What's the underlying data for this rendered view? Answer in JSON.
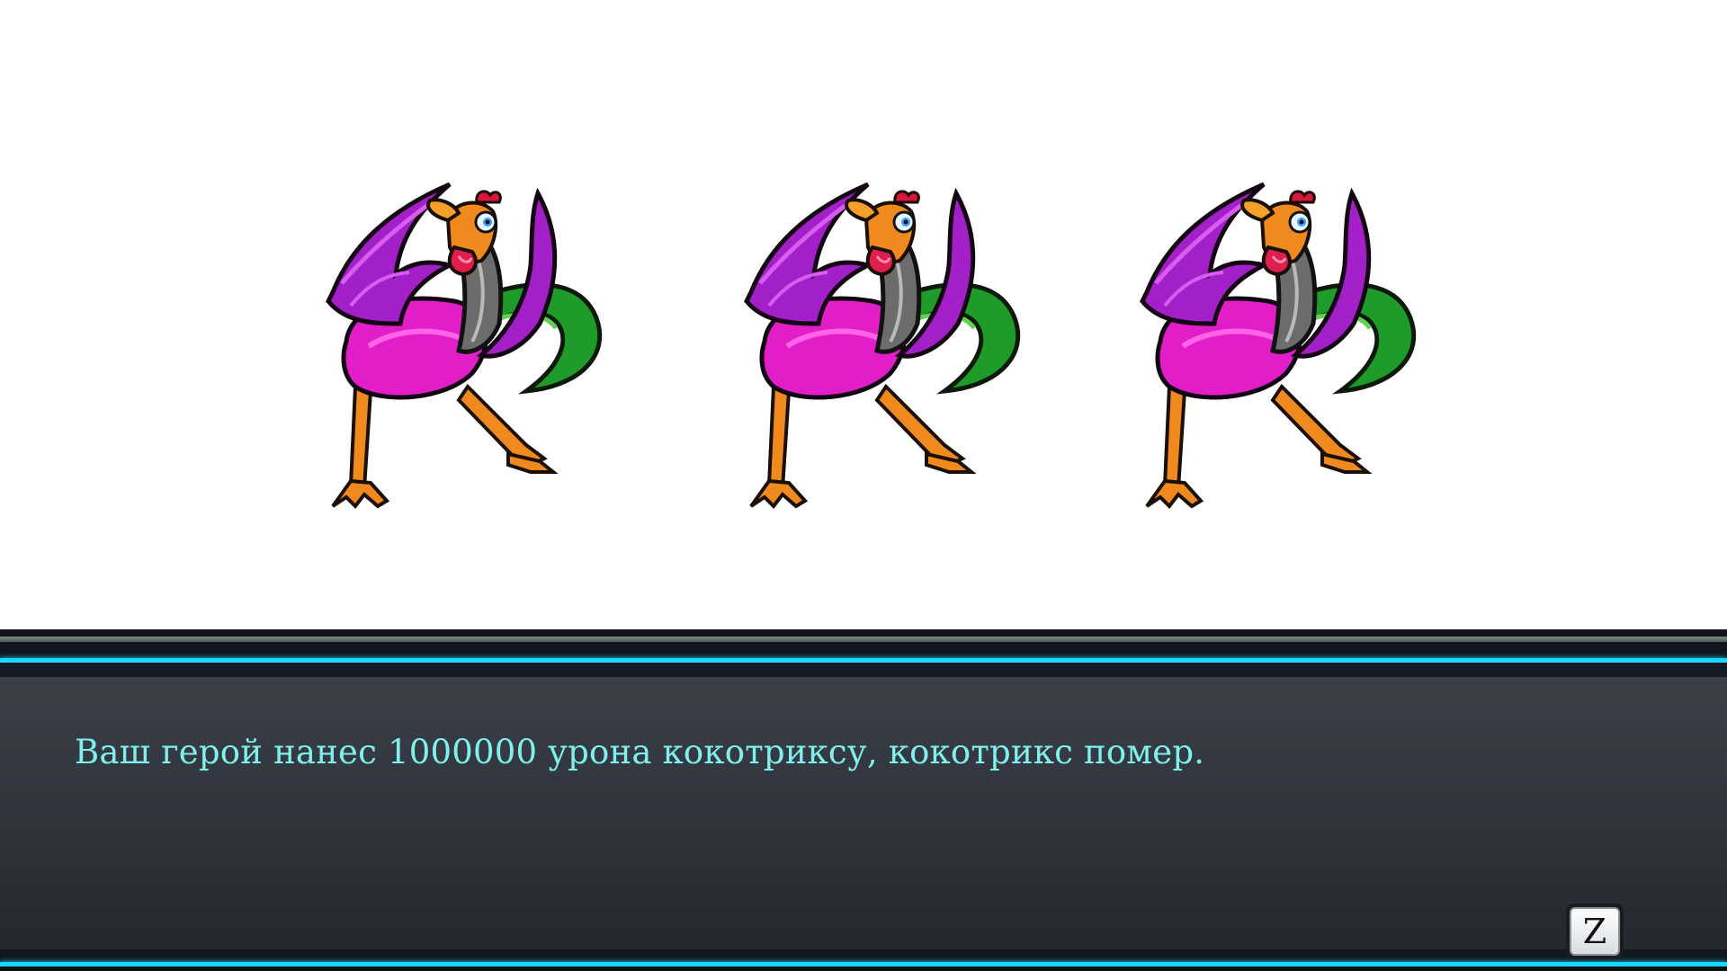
{
  "battle": {
    "enemies": [
      {
        "name": "cockatrice"
      },
      {
        "name": "cockatrice"
      },
      {
        "name": "cockatrice"
      }
    ]
  },
  "dialog": {
    "message": "Ваш герой нанес 1000000 урона кокотриксу, кокотрикс помер.",
    "confirm_key": "Z"
  },
  "colors": {
    "message_text": "#7ff0ec",
    "frame_accent": "#18d8ff",
    "panel": "#33373f"
  }
}
